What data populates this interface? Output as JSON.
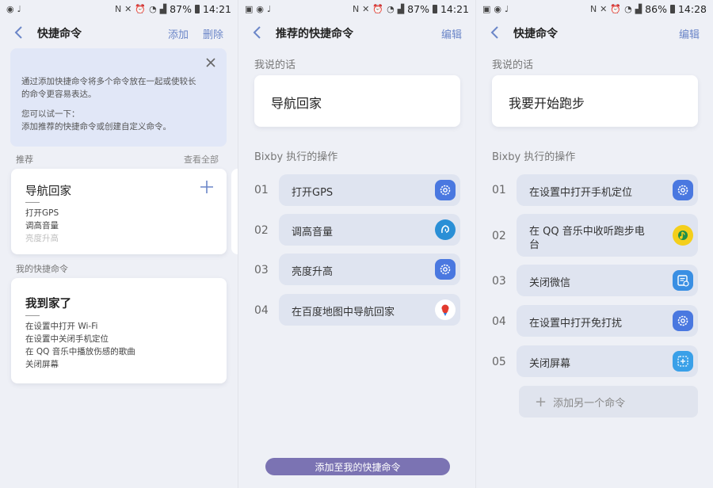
{
  "status": [
    {
      "percent": "87%",
      "time": "14:21"
    },
    {
      "percent": "87%",
      "time": "14:21"
    },
    {
      "percent": "86%",
      "time": "14:28"
    }
  ],
  "screen1": {
    "title": "快捷命令",
    "add_label": "添加",
    "delete_label": "删除",
    "info_line1": "通过添加快捷命令将多个命令放在一起或使较长",
    "info_line2": "的命令更容易表达。",
    "info_line3": "您可以试一下：",
    "info_line4": "添加推荐的快捷命令或创建自定义命令。",
    "recommend_label": "推荐",
    "see_all": "查看全部",
    "rec_card": {
      "title": "导航回家",
      "lines": [
        "打开GPS",
        "调高音量",
        "亮度升高"
      ]
    },
    "mine_label": "我的快捷命令",
    "my_card": {
      "title": "我到家了",
      "lines": [
        "在设置中打开 Wi-Fi",
        "在设置中关闭手机定位",
        "在 QQ 音乐中播放伤感的歌曲",
        "关闭屏幕"
      ]
    }
  },
  "screen2": {
    "title": "推荐的快捷命令",
    "edit_label": "编辑",
    "say_label": "我说的话",
    "say_text": "导航回家",
    "action_label": "Bixby 执行的操作",
    "actions": [
      {
        "num": "01",
        "text": "打开GPS",
        "icon": "settings-icon"
      },
      {
        "num": "02",
        "text": "调高音量",
        "icon": "bixby-icon"
      },
      {
        "num": "03",
        "text": "亮度升高",
        "icon": "settings-icon"
      },
      {
        "num": "04",
        "text": "在百度地图中导航回家",
        "icon": "baidu-map-icon"
      }
    ],
    "add_button": "添加至我的快捷命令"
  },
  "screen3": {
    "title": "快捷命令",
    "edit_label": "编辑",
    "say_label": "我说的话",
    "say_text": "我要开始跑步",
    "action_label": "Bixby 执行的操作",
    "actions": [
      {
        "num": "01",
        "text": "在设置中打开手机定位",
        "icon": "settings-icon"
      },
      {
        "num": "02",
        "text": "在 QQ 音乐中收听跑步电",
        "text2": "台",
        "icon": "qq-music-icon"
      },
      {
        "num": "03",
        "text": "关闭微信",
        "icon": "app-info-icon"
      },
      {
        "num": "04",
        "text": "在设置中打开免打扰",
        "icon": "settings-icon"
      },
      {
        "num": "05",
        "text": "关闭屏幕",
        "icon": "screen-off-icon"
      }
    ],
    "add_another": "添加另一个命令"
  },
  "colors": {
    "accent": "#6b86c8",
    "pill": "#dfe4f0",
    "settings_icon": "#4a78e0",
    "bottom_button": "#7b73b3"
  }
}
